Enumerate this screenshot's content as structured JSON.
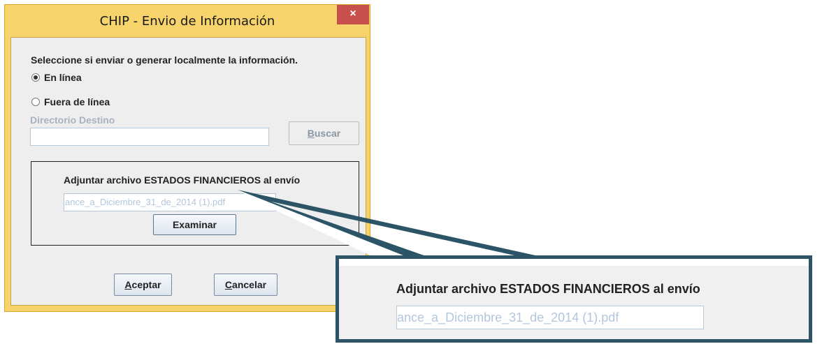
{
  "window": {
    "title": "CHIP - Envio de Información",
    "close_glyph": "×"
  },
  "dialog": {
    "prompt": "Seleccione si enviar o generar localmente la información.",
    "options": [
      {
        "label": "En línea",
        "selected": true
      },
      {
        "label": "Fuera de línea",
        "selected": false
      }
    ],
    "directory_label": "Directorio Destino",
    "directory_value": "",
    "buscar_rest": "uscar",
    "attach_title": "Adjuntar archivo ESTADOS FINANCIEROS al envío",
    "attach_file": "ance_a_Diciembre_31_de_2014 (1).pdf",
    "examinar_label": "Examinar",
    "aceptar_rest": "ceptar",
    "cancelar_rest": "ancelar"
  },
  "zoom": {
    "attach_title": "Adjuntar archivo ESTADOS FINANCIEROS al envío",
    "attach_file": "ance_a_Diciembre_31_de_2014 (1).pdf"
  },
  "colors": {
    "callout": "#2b5566",
    "window_frame": "#f6d36b",
    "close": "#c7504d"
  }
}
